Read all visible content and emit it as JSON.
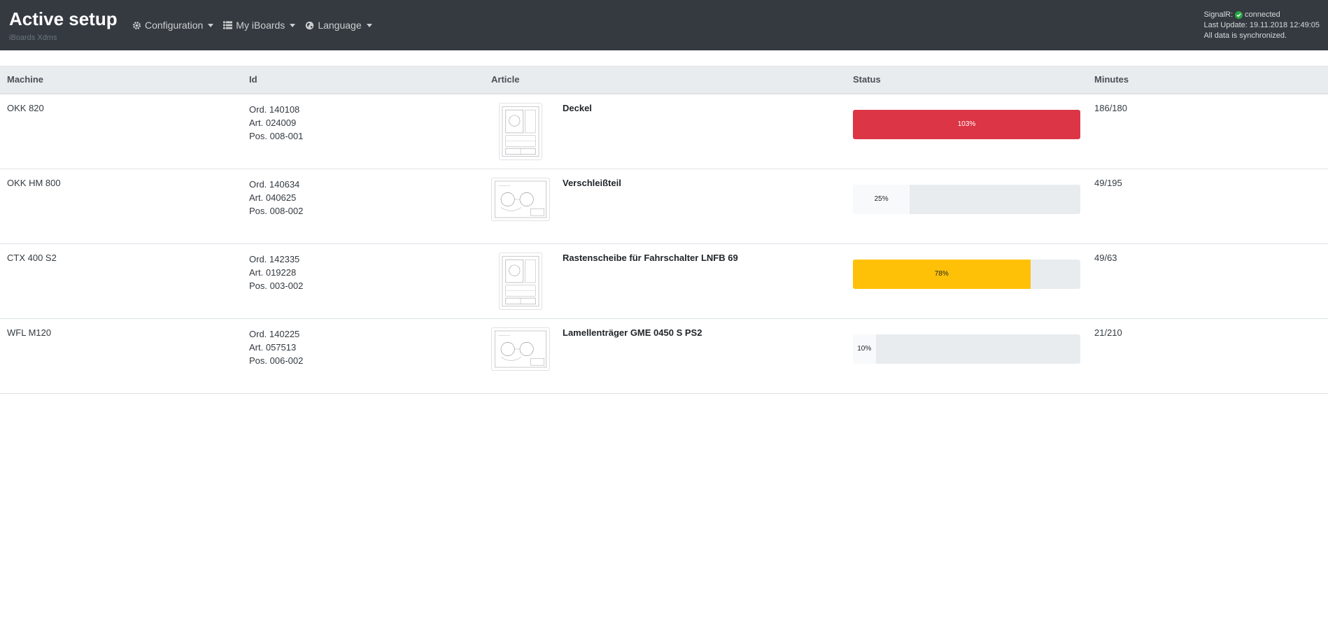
{
  "header": {
    "title": "Active setup",
    "subtitle": "iBoards Xdms",
    "menus": [
      {
        "label": "Configuration",
        "icon": "gear-icon"
      },
      {
        "label": "My iBoards",
        "icon": "list-icon"
      },
      {
        "label": "Language",
        "icon": "globe-icon"
      }
    ],
    "signalr_label": "SignalR:",
    "signalr_status": "connected",
    "last_update": "Last Update: 19.11.2018 12:49:05",
    "sync_status": "All data is synchronized."
  },
  "table": {
    "columns": [
      "Machine",
      "Id",
      "Article",
      "Status",
      "Minutes"
    ],
    "rows": [
      {
        "machine": "OKK 820",
        "ord": "Ord. 140108",
        "art": "Art. 024009",
        "pos": "Pos. 008-001",
        "article": "Deckel",
        "thumb": "portrait",
        "progress": 103,
        "progress_label": "103%",
        "bar_color": "#dc3545",
        "bar_text_color": "#ffffff",
        "minutes": "186/180"
      },
      {
        "machine": "OKK HM 800",
        "ord": "Ord. 140634",
        "art": "Art. 040625",
        "pos": "Pos. 008-002",
        "article": "Verschleißteil",
        "thumb": "landscape",
        "progress": 25,
        "progress_label": "25%",
        "bar_color": "#f8f9fa",
        "bar_text_color": "#212529",
        "minutes": "49/195"
      },
      {
        "machine": "CTX 400 S2",
        "ord": "Ord. 142335",
        "art": "Art. 019228",
        "pos": "Pos. 003-002",
        "article": "Rastenscheibe für Fahrschalter LNFB 69",
        "thumb": "portrait",
        "progress": 78,
        "progress_label": "78%",
        "bar_color": "#ffc107",
        "bar_text_color": "#212529",
        "minutes": "49/63"
      },
      {
        "machine": "WFL M120",
        "ord": "Ord. 140225",
        "art": "Art. 057513",
        "pos": "Pos. 006-002",
        "article": "Lamellenträger GME 0450 S PS2",
        "thumb": "landscape",
        "progress": 10,
        "progress_label": "10%",
        "bar_color": "#f8f9fa",
        "bar_text_color": "#212529",
        "minutes": "21/210"
      }
    ]
  }
}
